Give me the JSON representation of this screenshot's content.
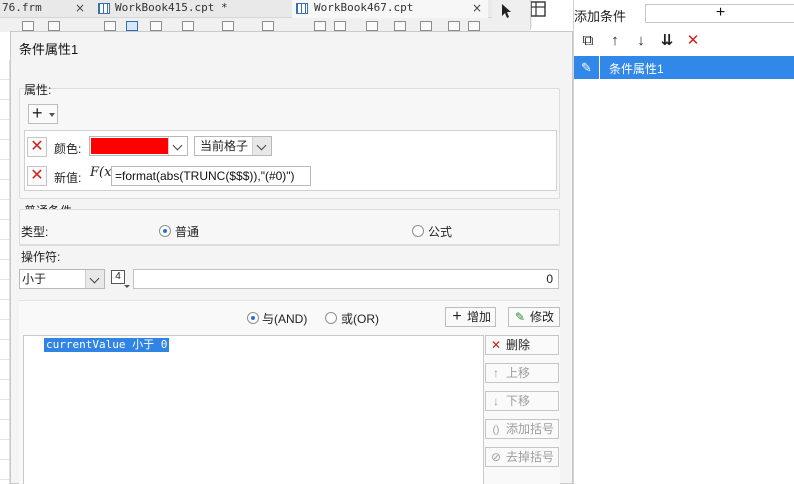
{
  "tabs": [
    {
      "label": "76.frm",
      "close": "×"
    },
    {
      "label": "WorkBook415.cpt *",
      "close": "×"
    },
    {
      "label": "WorkBook467.cpt",
      "close": "×"
    }
  ],
  "dialog": {
    "title": "条件属性1",
    "properties": {
      "section_label": "属性:",
      "add_symbol": "+",
      "rows": [
        {
          "delete_symbol": "✕",
          "label": "颜色:",
          "color": "#ff0000",
          "scope_value": "当前格子"
        },
        {
          "delete_symbol": "✕",
          "label": "新值:",
          "fx_label": "F(x)",
          "formula": "=format(abs(TRUNC($$$)),\"(#0)\")"
        }
      ]
    },
    "common_condition": {
      "section_label": "普通条件",
      "type_label": "类型:",
      "type_options": [
        {
          "label": "普通",
          "selected": true
        },
        {
          "label": "公式",
          "selected": false
        }
      ],
      "operator_label": "操作符:",
      "operator_value": "小于",
      "value_type_icon": "4",
      "value": "0"
    },
    "logic": {
      "options": [
        {
          "label": "与(AND)",
          "selected": true
        },
        {
          "label": "或(OR)",
          "selected": false
        }
      ],
      "add_button": {
        "symbol": "+",
        "label": "增加"
      },
      "modify_button": {
        "symbol": "✎",
        "label": "修改"
      }
    },
    "condition_list": [
      "currentValue 小于 0"
    ],
    "side_buttons": [
      {
        "symbol": "✕",
        "label": "删除",
        "enabled": true
      },
      {
        "symbol": "↑",
        "label": "上移",
        "enabled": false
      },
      {
        "symbol": "↓",
        "label": "下移",
        "enabled": false
      },
      {
        "symbol": "()",
        "label": "添加括号",
        "enabled": false
      },
      {
        "symbol": "⊘",
        "label": "去掉括号",
        "enabled": false
      }
    ]
  },
  "right_panel": {
    "title": "添加条件",
    "add_symbol": "+",
    "toolbar": [
      {
        "name": "copy-icon",
        "symbol": "⧉"
      },
      {
        "name": "move-up-icon",
        "symbol": "↑"
      },
      {
        "name": "move-down-icon",
        "symbol": "↓"
      },
      {
        "name": "move-bottom-icon",
        "symbol": "⇊"
      },
      {
        "name": "delete-icon",
        "symbol": "✕"
      }
    ],
    "items": [
      {
        "icon": "✎",
        "label": "条件属性1",
        "selected": true
      }
    ]
  }
}
